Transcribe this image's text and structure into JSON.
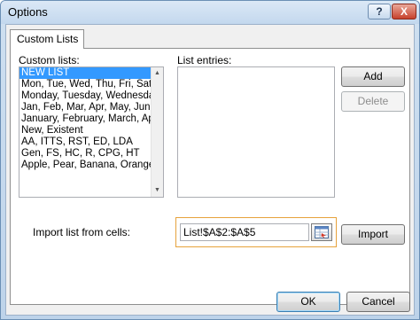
{
  "window": {
    "title": "Options",
    "help_label": "?",
    "close_label": "X"
  },
  "tabs": [
    {
      "label": "Custom Lists",
      "active": true
    }
  ],
  "custom_lists": {
    "label": "Custom lists:",
    "items": [
      "NEW LIST",
      "Mon, Tue, Wed, Thu, Fri, Sat, Su",
      "Monday, Tuesday, Wednesday, T",
      "Jan, Feb, Mar, Apr, May, Jun, Ju",
      "January, February, March, April",
      "New, Existent",
      "AA, ITTS, RST, ED, LDA",
      "Gen, FS, HC, R, CPG, HT",
      "Apple, Pear, Banana, Orange"
    ],
    "selected_index": 0
  },
  "list_entries": {
    "label": "List entries:",
    "value": ""
  },
  "buttons": {
    "add": "Add",
    "delete": "Delete",
    "import": "Import",
    "ok": "OK",
    "cancel": "Cancel"
  },
  "import": {
    "label": "Import list from cells:",
    "value": "List!$A$2:$A$5"
  },
  "colors": {
    "selection": "#3399ff",
    "focus_border": "#e6a23c"
  }
}
